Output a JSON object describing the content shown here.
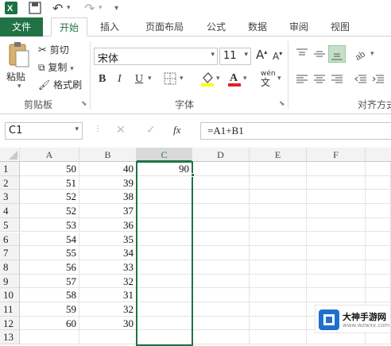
{
  "qat": {
    "undo_label": "↶",
    "redo_label": "↷"
  },
  "tabs": [
    {
      "label": "文件"
    },
    {
      "label": "开始"
    },
    {
      "label": "插入"
    },
    {
      "label": "页面布局"
    },
    {
      "label": "公式"
    },
    {
      "label": "数据"
    },
    {
      "label": "审阅"
    },
    {
      "label": "视图"
    }
  ],
  "clipboard": {
    "paste_label": "粘贴",
    "cut_label": "剪切",
    "copy_label": "复制",
    "format_painter_label": "格式刷",
    "group_label": "剪贴板"
  },
  "font": {
    "name": "宋体",
    "size": "11",
    "grow_label": "A",
    "shrink_label": "A",
    "bold_label": "B",
    "italic_label": "I",
    "underline_label": "U",
    "phonetic_label": "wén",
    "group_label": "字体"
  },
  "alignment": {
    "group_label": "对齐方式"
  },
  "formula_bar": {
    "name_box": "C1",
    "fx_label": "fx",
    "formula": "=A1+B1"
  },
  "columns": [
    "A",
    "B",
    "C",
    "D",
    "E",
    "F"
  ],
  "rows": [
    {
      "num": "1",
      "a": "50",
      "b": "40",
      "c": "90"
    },
    {
      "num": "2",
      "a": "51",
      "b": "39",
      "c": ""
    },
    {
      "num": "3",
      "a": "52",
      "b": "38",
      "c": ""
    },
    {
      "num": "4",
      "a": "52",
      "b": "37",
      "c": ""
    },
    {
      "num": "5",
      "a": "53",
      "b": "36",
      "c": ""
    },
    {
      "num": "6",
      "a": "54",
      "b": "35",
      "c": ""
    },
    {
      "num": "7",
      "a": "55",
      "b": "34",
      "c": ""
    },
    {
      "num": "8",
      "a": "56",
      "b": "33",
      "c": ""
    },
    {
      "num": "9",
      "a": "57",
      "b": "32",
      "c": ""
    },
    {
      "num": "10",
      "a": "58",
      "b": "31",
      "c": ""
    },
    {
      "num": "11",
      "a": "59",
      "b": "32",
      "c": ""
    },
    {
      "num": "12",
      "a": "60",
      "b": "30",
      "c": ""
    },
    {
      "num": "13",
      "a": "",
      "b": "",
      "c": ""
    }
  ],
  "watermark": {
    "text": "大神手游网",
    "url": "www.wzwxx.com"
  },
  "colors": {
    "accent": "#217346",
    "selection": "#217346"
  }
}
